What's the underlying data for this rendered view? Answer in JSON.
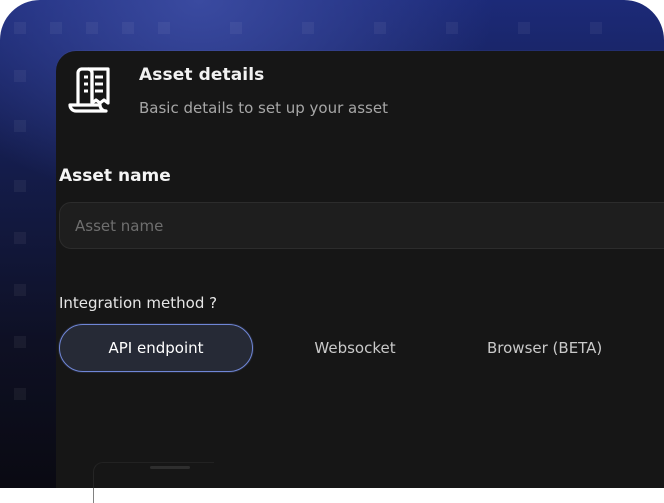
{
  "header": {
    "icon": "receipt-icon",
    "title": "Asset details",
    "subtitle": "Basic details to set up your asset"
  },
  "asset_name": {
    "label": "Asset name",
    "placeholder": "Asset name",
    "value": ""
  },
  "integration": {
    "label": "Integration method ?",
    "options": [
      {
        "label": "API endpoint",
        "selected": true
      },
      {
        "label": "Websocket",
        "selected": false
      },
      {
        "label": "Browser (BETA)",
        "selected": false
      }
    ]
  },
  "colors": {
    "panel": "#161616",
    "accent_border": "#6f86d6",
    "background_top": "#1c2a78"
  }
}
